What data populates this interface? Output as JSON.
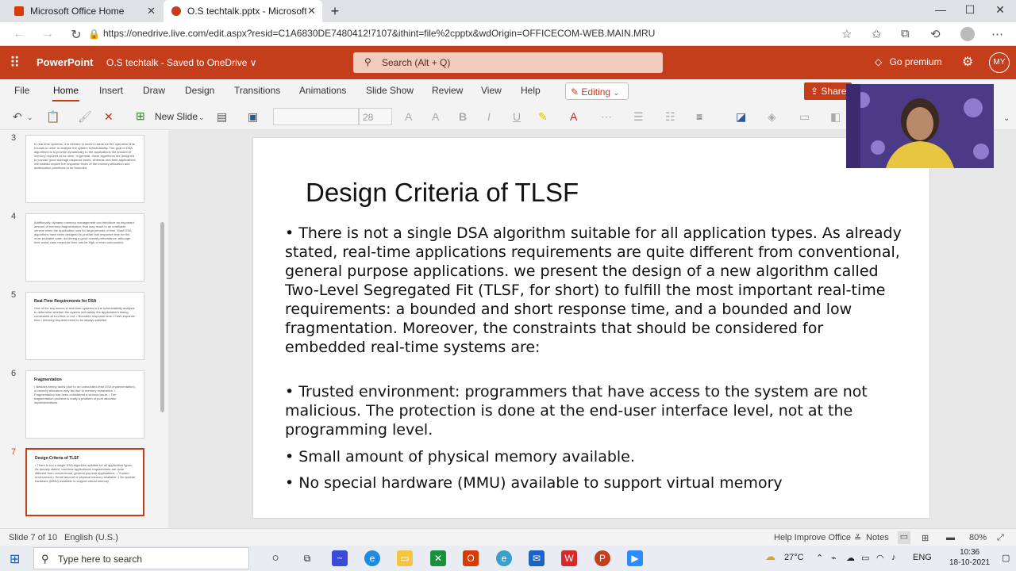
{
  "browser": {
    "tabs": [
      {
        "title": "Microsoft Office Home",
        "active": false
      },
      {
        "title": "O.S techtalk.pptx - Microsoft Po",
        "active": true
      }
    ],
    "url": "https://onedrive.live.com/edit.aspx?resid=C1A6830DE7480412!7107&ithint=file%2cpptx&wdOrigin=OFFICECOM-WEB.MAIN.MRU"
  },
  "office": {
    "app_name": "PowerPoint",
    "doc_title": "O.S techtalk - Saved to OneDrive ∨",
    "search_placeholder": "Search (Alt + Q)",
    "premium_label": "Go premium",
    "user_initials": "MY"
  },
  "ribbon": {
    "tabs": [
      "File",
      "Home",
      "Insert",
      "Draw",
      "Design",
      "Transitions",
      "Animations",
      "Slide Show",
      "Review",
      "View",
      "Help"
    ],
    "active_tab": "Home",
    "editing_label": "Editing",
    "share_label": "Share",
    "new_slide_label": "New Slide",
    "font_size": "28"
  },
  "thumbnails": [
    {
      "num": "3",
      "title": "",
      "body": "In real-time systems, it is needed to know in advance the operation time bounds in order to analyse the system schedulability. The goal of DSA algorithms is to provide dynamically to the applications the amount of memory required at run time. In general, these algorithms are designed to provide good average response times, whereas real-time applications will instead require the response times of the memory allocation and deallocation primitives to be bounded."
    },
    {
      "num": "4",
      "title": "",
      "body": "Additionally, dynamic memory management can introduce an important amount of memory fragmentation, that may result in an unreliable service when the application runs for large periods of time. Most DSA algorithms have been designed to provide fast response time for the most probable case, achieving a good overall performance, although their worst-case response time can be high or even unbounded."
    },
    {
      "num": "5",
      "title": "Real-Time Requirements for DSA",
      "body": "One of the key issues in real-time systems is the schedulability analysis to determine whether the system will satisfy the application's timing constraints at run-time or not. • Bounded response time • Fast response time • Memory requests need to be always satisfied"
    },
    {
      "num": "6",
      "title": "Fragmentation",
      "body": "• Besides timing faults (due to an unbounded time DSA implementation), a memory allocation may fail due to memory exhaustion. • Fragmentation has been considered a serious issue. • The fragmentation problem is really a problem of poor allocator implementations."
    },
    {
      "num": "7",
      "title": "Design Criteria of TLSF",
      "body": "• There is not a single DSA algorithm suitable for all application types. As already stated, real-time applications requirements are quite different from conventional, general purpose applications. • Trusted environment • Small amount of physical memory available. • No special hardware (MMU) available to support virtual memory"
    }
  ],
  "slide": {
    "title": "Design Criteria of TLSF",
    "bullets": [
      "• There is not a single DSA algorithm suitable for all application types. As already stated, real-time applications requirements are quite different from conventional, general purpose applications. we present the design of a new algorithm called Two-Level Segregated Fit (TLSF, for short) to fulfill the most important real-time requirements: a bounded and short response time, and a bounded and low fragmentation. Moreover, the constraints that should be considered for embedded real-time systems are:",
      " • Trusted environment: programmers that have access to the system are not malicious. The protection is done at the end-user interface level, not at the programming level.",
      "• Small amount of physical memory available.",
      "• No special hardware (MMU) available to support virtual memory"
    ]
  },
  "statusbar": {
    "slide_info": "Slide 7 of 10",
    "language": "English (U.S.)",
    "help": "Help Improve Office",
    "notes": "Notes",
    "zoom": "80%"
  },
  "taskbar": {
    "search_placeholder": "Type here to search",
    "weather": "27°C",
    "lang": "ENG",
    "time": "10:36",
    "date": "18-10-2021"
  },
  "colors": {
    "office_red": "#c43e1c",
    "ribbon_bg": "#f3f3f3"
  }
}
